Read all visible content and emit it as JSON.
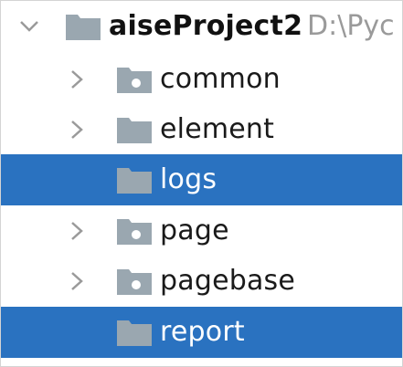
{
  "project": {
    "name": "aiseProject2",
    "path": "D:\\Pyc",
    "expanded": true
  },
  "items": [
    {
      "label": "common",
      "expandable": true,
      "has_marker": true,
      "selected": false
    },
    {
      "label": "element",
      "expandable": true,
      "has_marker": false,
      "selected": false
    },
    {
      "label": "logs",
      "expandable": false,
      "has_marker": false,
      "selected": true
    },
    {
      "label": "page",
      "expandable": true,
      "has_marker": true,
      "selected": false
    },
    {
      "label": "pagebase",
      "expandable": true,
      "has_marker": true,
      "selected": false
    },
    {
      "label": "report",
      "expandable": false,
      "has_marker": false,
      "selected": true
    }
  ],
  "colors": {
    "selection": "#2a72c0",
    "folder": "#9aa7b0",
    "chevron": "#9a9a9a"
  }
}
